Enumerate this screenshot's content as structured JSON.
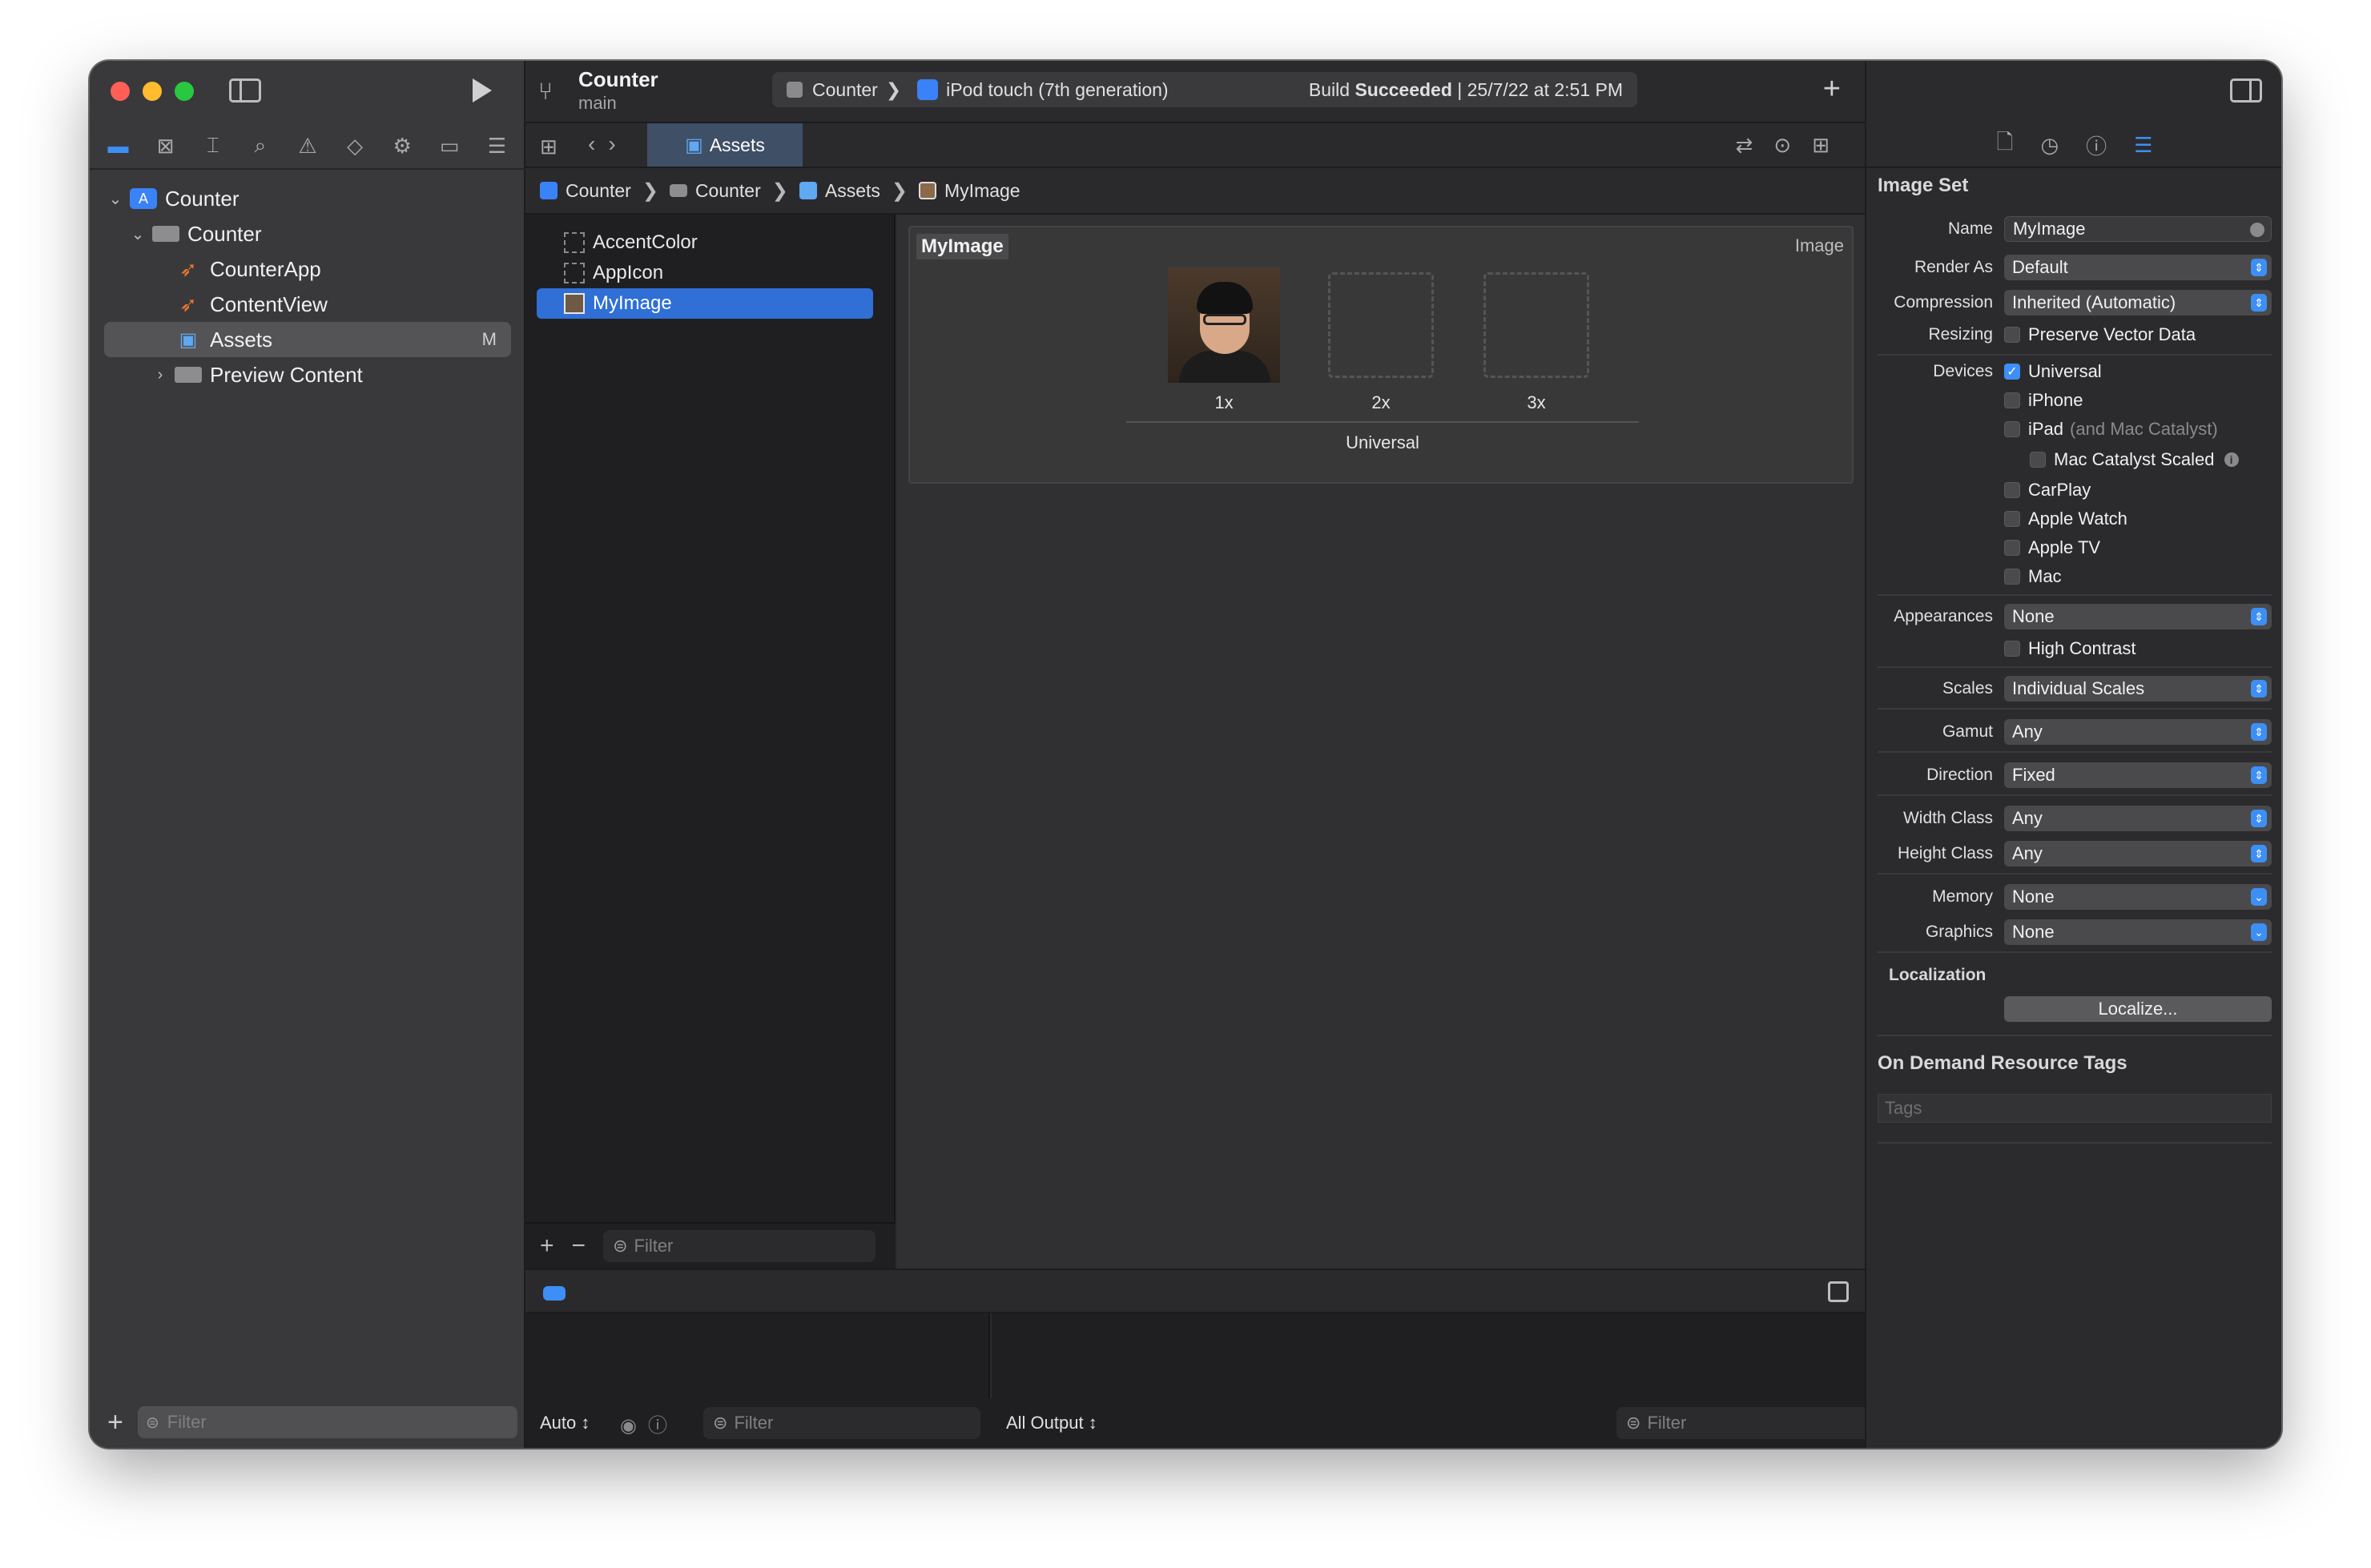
{
  "navigator": {
    "tree": [
      {
        "label": "Counter",
        "icon": "app-icon"
      },
      {
        "label": "Counter",
        "icon": "folder-icon"
      },
      {
        "label": "CounterApp",
        "icon": "swift-icon"
      },
      {
        "label": "ContentView",
        "icon": "swift-icon"
      },
      {
        "label": "Assets",
        "icon": "asset-catalog-icon",
        "badge": "M"
      },
      {
        "label": "Preview Content",
        "icon": "folder-icon"
      }
    ],
    "filter_placeholder": "Filter"
  },
  "toolbar": {
    "project": "Counter",
    "branch": "main",
    "scheme": "Counter",
    "device": "iPod touch (7th generation)",
    "build_prefix": "Build ",
    "build_status": "Succeeded",
    "build_time": " | 25/7/22 at 2:51 PM"
  },
  "editor": {
    "tab": "Assets",
    "breadcrumb": [
      "Counter",
      "Counter",
      "Assets",
      "MyImage"
    ]
  },
  "asset_list": {
    "items": [
      "AccentColor",
      "AppIcon",
      "MyImage"
    ],
    "selected": "MyImage",
    "filter_placeholder": "Filter"
  },
  "image_set": {
    "name": "MyImage",
    "kind": "Image",
    "slots": [
      "1x",
      "2x",
      "3x"
    ],
    "group_label": "Universal"
  },
  "debug": {
    "auto_label": "Auto ↕",
    "filter_placeholder": "Filter",
    "output_label": "All Output ↕",
    "console_filter_placeholder": "Filter"
  },
  "inspector": {
    "section_title": "Image Set",
    "name_label": "Name",
    "name_value": "MyImage",
    "render_as_label": "Render As",
    "render_as_value": "Default",
    "compression_label": "Compression",
    "compression_value": "Inherited (Automatic)",
    "resizing_label": "Resizing",
    "resizing_option": "Preserve Vector Data",
    "devices_label": "Devices",
    "devices": {
      "universal": "Universal",
      "iphone": "iPhone",
      "ipad": "iPad",
      "ipad_note": "(and Mac Catalyst)",
      "mac_catalyst_scaled": "Mac Catalyst Scaled",
      "carplay": "CarPlay",
      "apple_watch": "Apple Watch",
      "apple_tv": "Apple TV",
      "mac": "Mac"
    },
    "appearances_label": "Appearances",
    "appearances_value": "None",
    "high_contrast": "High Contrast",
    "scales_label": "Scales",
    "scales_value": "Individual Scales",
    "gamut_label": "Gamut",
    "gamut_value": "Any",
    "direction_label": "Direction",
    "direction_value": "Fixed",
    "width_class_label": "Width Class",
    "width_class_value": "Any",
    "height_class_label": "Height Class",
    "height_class_value": "Any",
    "memory_label": "Memory",
    "memory_value": "None",
    "graphics_label": "Graphics",
    "graphics_value": "None",
    "localization_title": "Localization",
    "localize_button": "Localize...",
    "odr_title": "On Demand Resource Tags",
    "tags_placeholder": "Tags"
  },
  "colors": {
    "accent": "#3d8ff5",
    "selection": "#2f6fd6",
    "traffic_red": "#ff5f57",
    "traffic_yellow": "#febc2e",
    "traffic_green": "#28c840"
  }
}
